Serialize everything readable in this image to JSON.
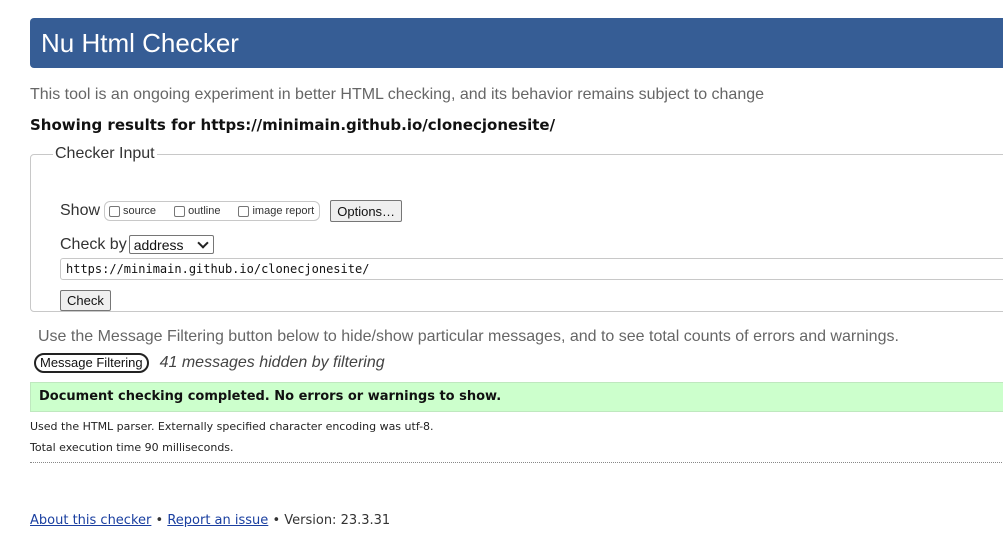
{
  "header": {
    "title": "Nu Html Checker"
  },
  "intro": "This tool is an ongoing experiment in better HTML checking, and its behavior remains subject to change",
  "results_heading": "Showing results for https://minimain.github.io/clonecjonesite/",
  "checker_input": {
    "legend": "Checker Input",
    "show_label": "Show",
    "show_options": [
      {
        "label": "source",
        "checked": false
      },
      {
        "label": "outline",
        "checked": false
      },
      {
        "label": "image report",
        "checked": false
      }
    ],
    "options_button": "Options…",
    "check_by_label": "Check by",
    "check_by_selected": "address",
    "url_value": "https://minimain.github.io/clonecjonesite/",
    "check_button": "Check"
  },
  "filtering": {
    "note": "Use the Message Filtering button below to hide/show particular messages, and to see total counts of errors and warnings.",
    "button": "Message Filtering",
    "hidden_count": "41 messages hidden by filtering"
  },
  "result": {
    "status": "Document checking completed. No errors or warnings to show.",
    "parser_note": "Used the HTML parser. Externally specified character encoding was utf-8.",
    "execution_time": "Total execution time 90 milliseconds."
  },
  "footer": {
    "about_link": "About this checker",
    "separator": "•",
    "report_link": "Report an issue",
    "version": "Version: 23.3.31"
  },
  "colors": {
    "header_bg": "#365d95",
    "success_bg": "#ccffcc",
    "link": "#1a3fa0"
  }
}
